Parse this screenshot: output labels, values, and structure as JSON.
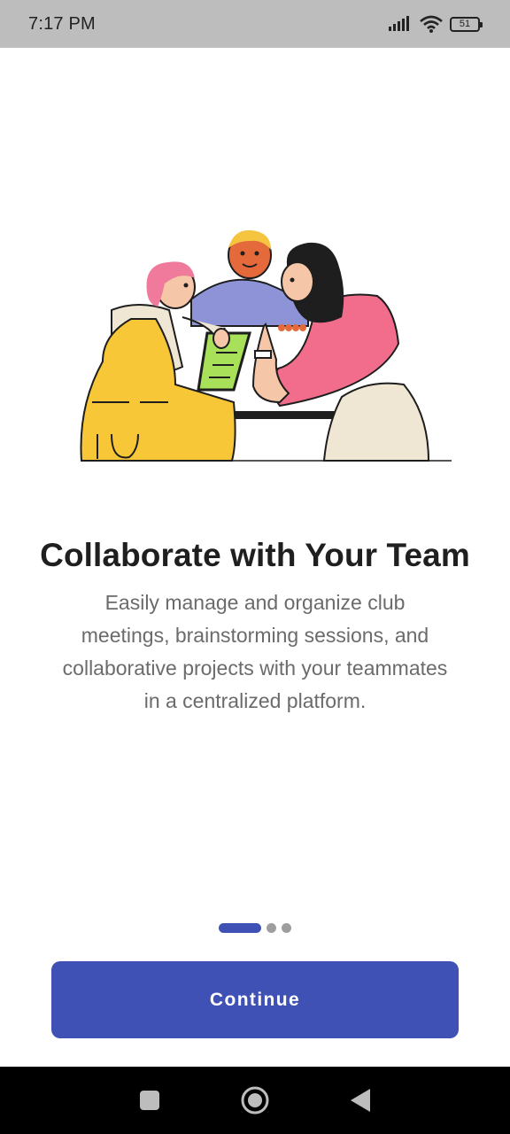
{
  "status_bar": {
    "time": "7:17 PM",
    "battery": "51"
  },
  "onboarding": {
    "title": "Collaborate with Your Team",
    "description": "Easily manage and organize club meetings, brainstorming sessions, and collaborative projects with your teammates in a centralized platform.",
    "illustration": "team-collaboration-illustration",
    "pager": {
      "total": 3,
      "active": 1
    },
    "continue_label": "Continue"
  },
  "colors": {
    "accent": "#3f51b5",
    "status_bar": "#bdbdbd",
    "nav_bar": "#000000"
  },
  "nav": {
    "icons": [
      "recent-apps-icon",
      "home-icon",
      "back-icon"
    ]
  }
}
